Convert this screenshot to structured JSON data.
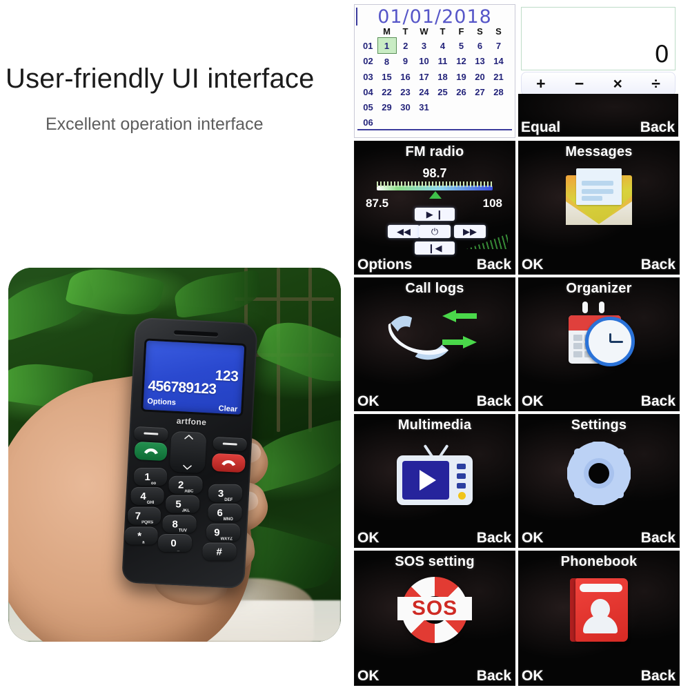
{
  "left": {
    "headline": "User-friendly UI interface",
    "subhead": "Excellent operation interface",
    "photo": {
      "brand": "artfone",
      "screen": {
        "number_top": "123",
        "number_main": "456789123",
        "softkey_left": "Options",
        "softkey_right": "Clear"
      },
      "keys": [
        {
          "digit": "1",
          "letters": "oo"
        },
        {
          "digit": "2",
          "letters": "ABC"
        },
        {
          "digit": "3",
          "letters": "DEF"
        },
        {
          "digit": "4",
          "letters": "GHI"
        },
        {
          "digit": "5",
          "letters": "JKL"
        },
        {
          "digit": "6",
          "letters": "MNO"
        },
        {
          "digit": "7",
          "letters": "PQRS"
        },
        {
          "digit": "8",
          "letters": "TUV"
        },
        {
          "digit": "9",
          "letters": "WXYZ"
        },
        {
          "digit": "*",
          "letters": "a"
        },
        {
          "digit": "0",
          "letters": "_"
        },
        {
          "digit": "#",
          "letters": ""
        }
      ]
    }
  },
  "calendar": {
    "date_title": "01/01/2018",
    "weekday_headers": [
      "M",
      "T",
      "W",
      "T",
      "F",
      "S",
      "S"
    ],
    "week_numbers": [
      "01",
      "02",
      "03",
      "04",
      "05",
      "06"
    ],
    "weeks": [
      [
        "1",
        "2",
        "3",
        "4",
        "5",
        "6",
        "7"
      ],
      [
        "8",
        "9",
        "10",
        "11",
        "12",
        "13",
        "14"
      ],
      [
        "15",
        "16",
        "17",
        "18",
        "19",
        "20",
        "21"
      ],
      [
        "22",
        "23",
        "24",
        "25",
        "26",
        "27",
        "28"
      ],
      [
        "29",
        "30",
        "31",
        "",
        "",
        "",
        ""
      ],
      [
        "",
        "",
        "",
        "",
        "",
        "",
        ""
      ]
    ],
    "selected_day": "1",
    "accent_color": "#5656c8",
    "selected_bg": "#c9ecc4"
  },
  "calculator": {
    "display_value": "0",
    "operators": [
      "+",
      "−",
      "×",
      "÷"
    ],
    "softkey_left": "Equal",
    "softkey_right": "Back"
  },
  "fm_radio": {
    "title": "FM radio",
    "frequency": "98.7",
    "range_min": "87.5",
    "range_max": "108",
    "controls": [
      "▶ ❙",
      "◀◀",
      "⏻",
      "▶▶",
      "❙◀"
    ],
    "softkey_left": "Options",
    "softkey_right": "Back"
  },
  "menu_screens": [
    {
      "title": "Messages",
      "icon": "envelope-icon",
      "softkey_left": "OK",
      "softkey_right": "Back"
    },
    {
      "title": "Call logs",
      "icon": "call-log-handset-icon",
      "softkey_left": "OK",
      "softkey_right": "Back"
    },
    {
      "title": "Organizer",
      "icon": "calendar-clock-icon",
      "softkey_left": "OK",
      "softkey_right": "Back"
    },
    {
      "title": "Multimedia",
      "icon": "television-play-icon",
      "softkey_left": "OK",
      "softkey_right": "Back"
    },
    {
      "title": "Settings",
      "icon": "gear-icon",
      "softkey_left": "OK",
      "softkey_right": "Back"
    },
    {
      "title": "SOS setting",
      "icon": "life-ring-sos-icon",
      "softkey_left": "OK",
      "softkey_right": "Back"
    },
    {
      "title": "Phonebook",
      "icon": "contact-book-icon",
      "softkey_left": "OK",
      "softkey_right": "Back"
    }
  ],
  "sos_label": "SOS",
  "colors": {
    "calendar_accent": "#5656c8",
    "messages_envelope": "#d9d23c",
    "organizer_red": "#e0403c",
    "organizer_blue": "#2a72d8",
    "settings_gear": "#bcd2f5",
    "sos_red": "#e23b33",
    "phonebook_red": "#e0352e",
    "call_arrow_green": "#4ad84a",
    "screen_blue": "#2a49cf"
  }
}
